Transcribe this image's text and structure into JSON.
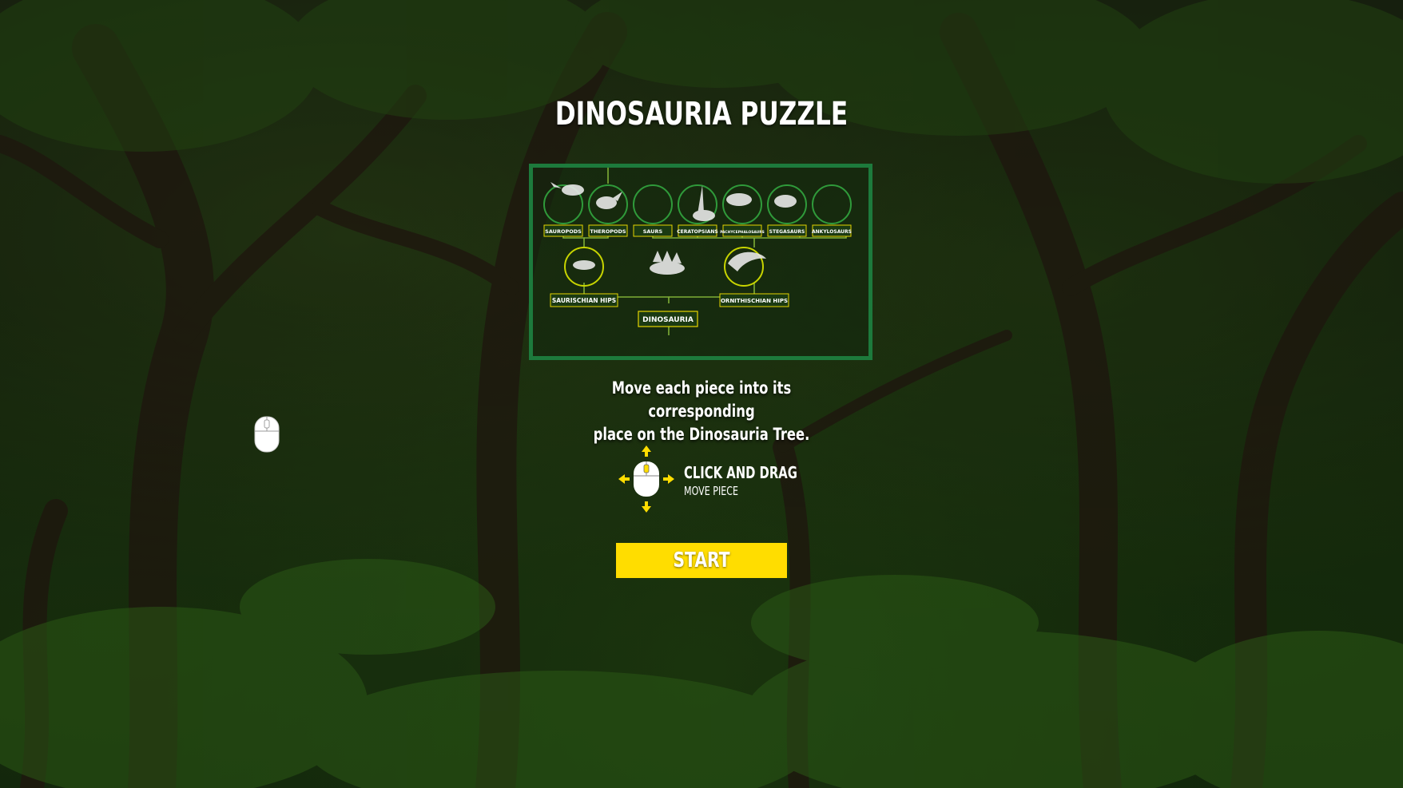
{
  "game": {
    "title": "DINOSAURIA PUZZLE",
    "instructions_line1": "Move each piece into its corresponding",
    "instructions_line2": "place on the Dinosauria Tree.",
    "control_title": "CLICK AND DRAG",
    "control_subtitle": "MOVE PIECE",
    "start_label": "START"
  },
  "tree": {
    "top_nodes": [
      "SAUROPODS",
      "THEROPODS",
      "SAURS",
      "CERATOPSIANS",
      "PACHYCEPHALOSAURS",
      "STEGASAURS",
      "ANKYLOSAURS"
    ],
    "mid_nodes": [
      "SAURISCHIAN HIPS",
      "ORNITHISCHIAN HIPS"
    ],
    "root_node": "DINOSAURIA"
  },
  "colors": {
    "panel_border": "#1d7a3c",
    "node_outline": "#2f9a3a",
    "label_border": "#e6d400",
    "start_button": "#ffdd00",
    "arrow": "#ffdd00"
  },
  "icons": {
    "cursor": "mouse-cursor-icon",
    "control": "mouse-drag-icon"
  }
}
